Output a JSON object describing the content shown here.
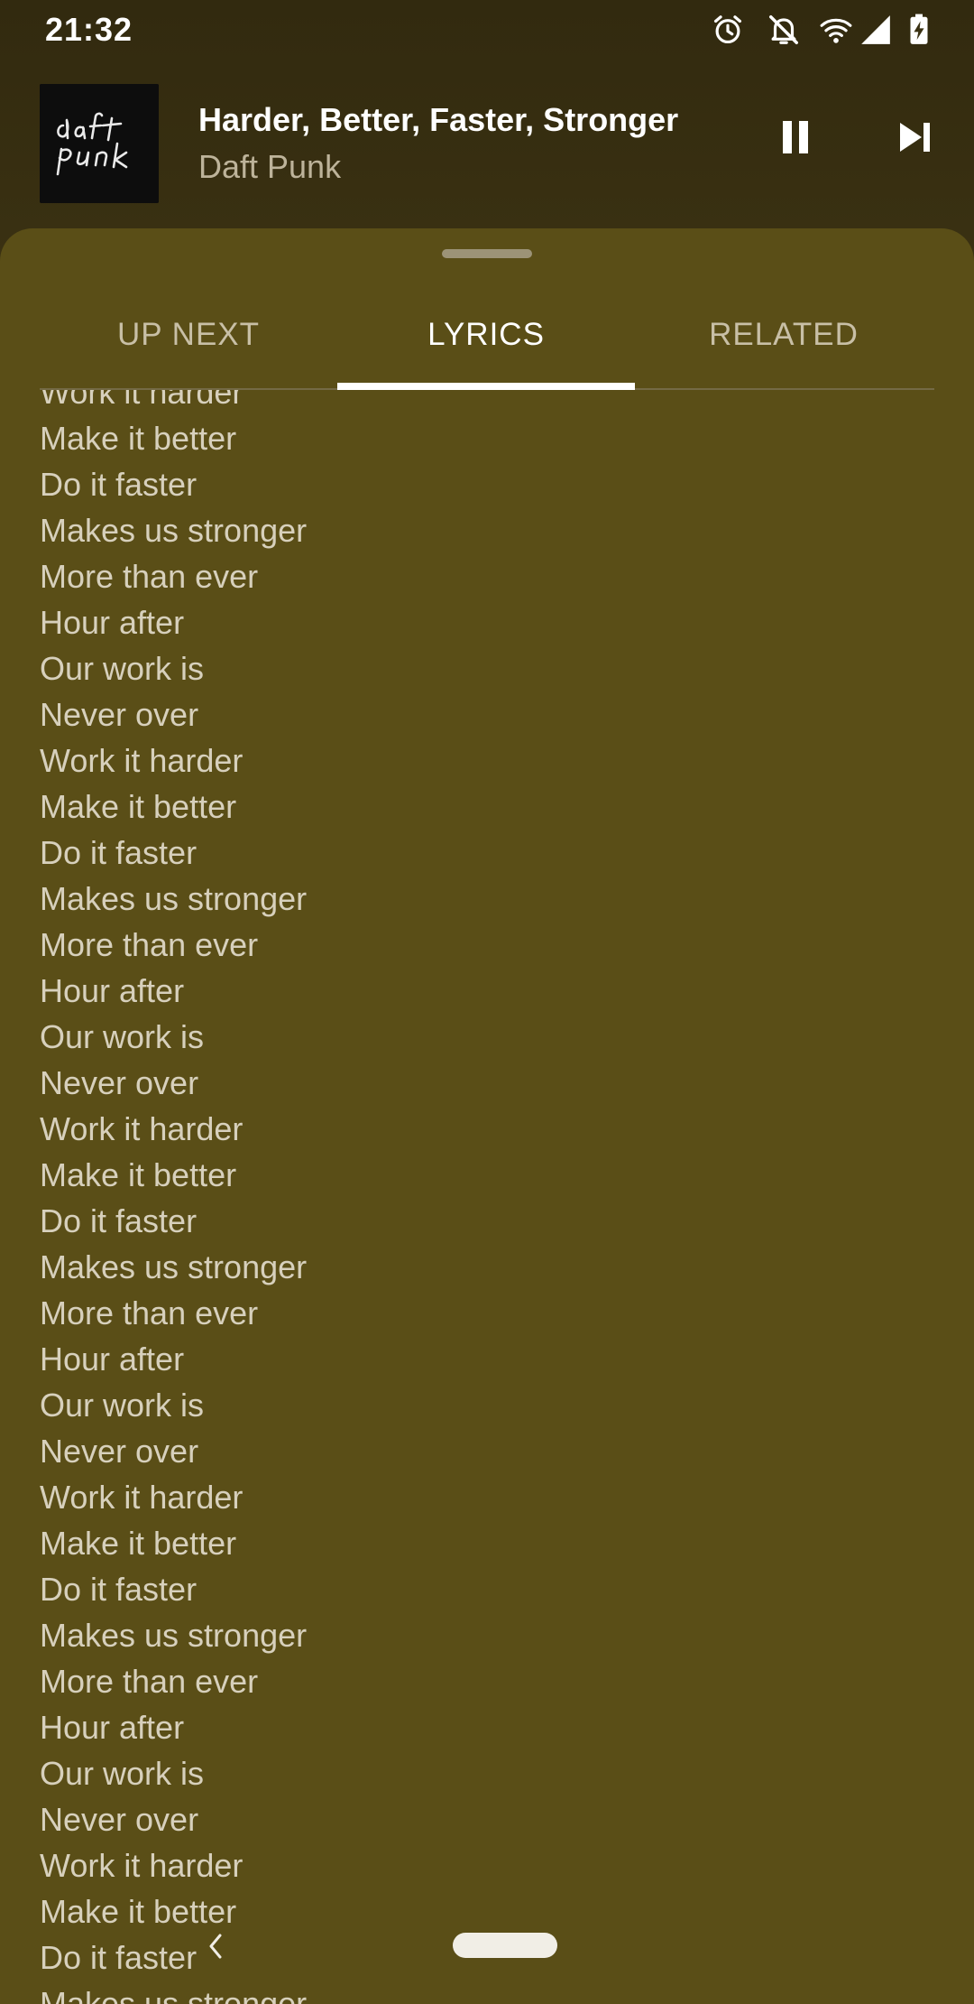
{
  "status_bar": {
    "time": "21:32",
    "icons": [
      "alarm-icon",
      "notifications-off-icon",
      "wifi-icon",
      "cell-signal-icon",
      "battery-charging-icon"
    ]
  },
  "mini_player": {
    "title": "Harder, Better, Faster, Stronger",
    "artist": "Daft Punk",
    "album_art_text": "daft punk",
    "controls": [
      "pause-icon",
      "skip-next-icon"
    ]
  },
  "tabs": [
    {
      "label": "UP NEXT",
      "active": false
    },
    {
      "label": "LYRICS",
      "active": true
    },
    {
      "label": "RELATED",
      "active": false
    }
  ],
  "lyrics": [
    "Work it harder",
    "Make it better",
    "Do it faster",
    "Makes us stronger",
    "More than ever",
    "Hour after",
    "Our work is",
    "Never over",
    "Work it harder",
    "Make it better",
    "Do it faster",
    "Makes us stronger",
    "More than ever",
    "Hour after",
    "Our work is",
    "Never over",
    "Work it harder",
    "Make it better",
    "Do it faster",
    "Makes us stronger",
    "More than ever",
    "Hour after",
    "Our work is",
    "Never over",
    "Work it harder",
    "Make it better",
    "Do it faster",
    "Makes us stronger",
    "More than ever",
    "Hour after",
    "Our work is",
    "Never over",
    "Work it harder",
    "Make it better",
    "Do it faster",
    "Makes us stronger"
  ],
  "colors": {
    "sheet_background": "#5a4e17",
    "top_background": "#322a0f",
    "lyric_text": "#d7d0bc",
    "active_tab": "#ffffff",
    "inactive_tab": "#c8bfa6"
  }
}
